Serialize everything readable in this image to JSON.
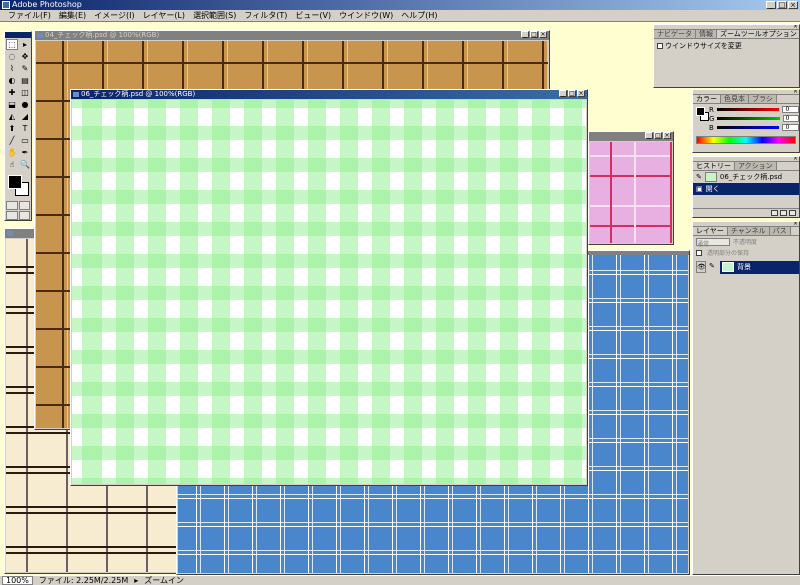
{
  "app": {
    "title": "Adobe Photoshop",
    "window_buttons": [
      "_",
      "□",
      "×"
    ]
  },
  "menu": [
    "ファイル(F)",
    "編集(E)",
    "イメージ(I)",
    "レイヤー(L)",
    "選択範囲(S)",
    "フィルタ(T)",
    "ビュー(V)",
    "ウインドウ(W)",
    "ヘルプ(H)"
  ],
  "toolbox": {
    "tools": [
      "⬚",
      "▸",
      "◌",
      "✥",
      "⌇",
      "✎",
      "◐",
      "▤",
      "✚",
      "◫",
      "⬓",
      "●",
      "◭",
      "◢",
      "⬆",
      "T",
      "╱",
      "▭",
      "✋",
      "✒",
      "☝",
      "🔍"
    ]
  },
  "documents": [
    {
      "title": "04_チェック柄.psd @ 100%(RGB)"
    },
    {
      "title": ""
    },
    {
      "title": ""
    },
    {
      "title": ""
    },
    {
      "title": "06_チェック柄.psd @ 100%(RGB)"
    }
  ],
  "navigator": {
    "tabs": [
      "ナビゲータ",
      "情報",
      "ズームツールオプション"
    ],
    "option_label": "ウインドウサイズを変更"
  },
  "color_palette": {
    "tabs": [
      "カラー",
      "色見本",
      "ブラシ"
    ],
    "channels": [
      {
        "label": "R",
        "value": "0",
        "color": "#ff0000"
      },
      {
        "label": "G",
        "value": "0",
        "color": "#00aa00"
      },
      {
        "label": "B",
        "value": "0",
        "color": "#0000ff"
      }
    ]
  },
  "history_palette": {
    "tabs": [
      "ヒストリー",
      "アクション"
    ],
    "snapshot": "06_チェック柄.psd",
    "step": "開く"
  },
  "layers_palette": {
    "tabs": [
      "レイヤー",
      "チャンネル",
      "パス"
    ],
    "blend_mode": "通常",
    "opacity_label": "不透明度",
    "preserve_label": "透明部分の保持",
    "layer_name": "背景"
  },
  "status": {
    "zoom": "100%",
    "file_info": "ファイル: 2.25M/2.25M",
    "hint": "ズームイン"
  }
}
